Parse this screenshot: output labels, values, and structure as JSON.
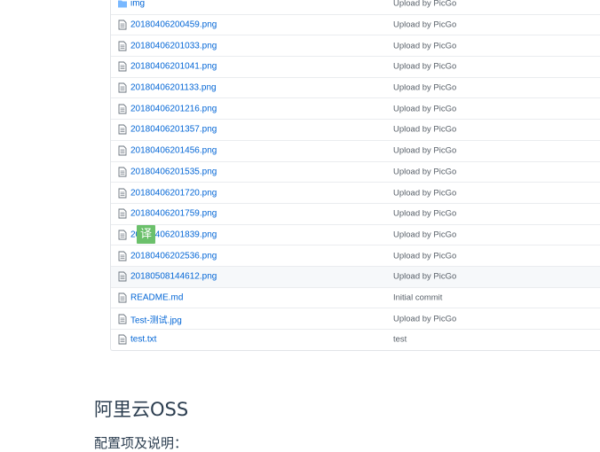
{
  "file_list": {
    "rows": [
      {
        "icon": "folder-icon",
        "name": "img",
        "message": "Upload by PicGo"
      },
      {
        "icon": "file-icon",
        "name": "20180406200459.png",
        "message": "Upload by PicGo"
      },
      {
        "icon": "file-icon",
        "name": "20180406201033.png",
        "message": "Upload by PicGo"
      },
      {
        "icon": "file-icon",
        "name": "20180406201041.png",
        "message": "Upload by PicGo"
      },
      {
        "icon": "file-icon",
        "name": "20180406201133.png",
        "message": "Upload by PicGo"
      },
      {
        "icon": "file-icon",
        "name": "20180406201216.png",
        "message": "Upload by PicGo"
      },
      {
        "icon": "file-icon",
        "name": "20180406201357.png",
        "message": "Upload by PicGo"
      },
      {
        "icon": "file-icon",
        "name": "20180406201456.png",
        "message": "Upload by PicGo"
      },
      {
        "icon": "file-icon",
        "name": "20180406201535.png",
        "message": "Upload by PicGo"
      },
      {
        "icon": "file-icon",
        "name": "20180406201720.png",
        "message": "Upload by PicGo"
      },
      {
        "icon": "file-icon",
        "name": "20180406201759.png",
        "message": "Upload by PicGo"
      },
      {
        "icon": "file-icon",
        "name": "20180406201839.png",
        "message": "Upload by PicGo"
      },
      {
        "icon": "file-icon",
        "name": "20180406202536.png",
        "message": "Upload by PicGo"
      },
      {
        "icon": "file-icon",
        "name": "20180508144612.png",
        "message": "Upload by PicGo",
        "highlighted": true
      },
      {
        "icon": "file-icon",
        "name": "README.md",
        "message": "Initial commit"
      },
      {
        "icon": "file-icon",
        "name": "Test-测试.jpg",
        "message": "Upload by PicGo"
      },
      {
        "icon": "file-icon",
        "name": "test.txt",
        "message": "test"
      }
    ]
  },
  "translate_badge": {
    "label": "译",
    "color": "#6bc06b"
  },
  "section": {
    "heading": "阿里云OSS",
    "paragraph": "配置项及说明："
  },
  "colors": {
    "link": "#0366d6",
    "muted": "#586069",
    "heading": "#2c3e50",
    "icon": "#6a737d",
    "row_highlight": "#f6f8fa"
  }
}
